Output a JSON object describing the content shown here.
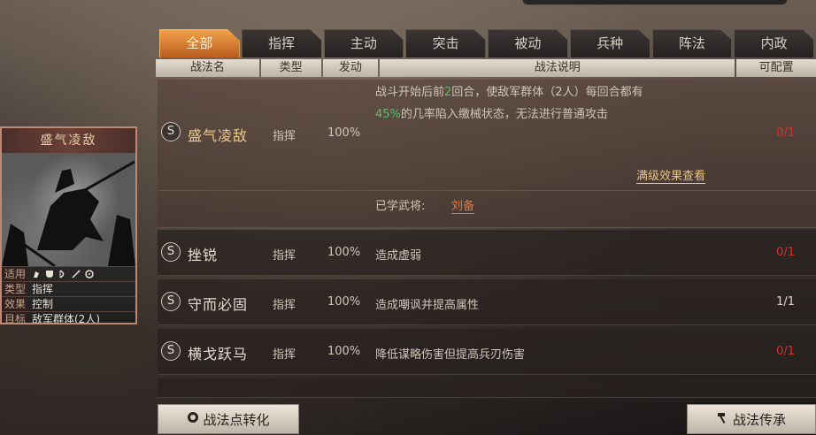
{
  "tabs": [
    {
      "label": "全部",
      "active": true
    },
    {
      "label": "指挥",
      "active": false
    },
    {
      "label": "主动",
      "active": false
    },
    {
      "label": "突击",
      "active": false
    },
    {
      "label": "被动",
      "active": false
    },
    {
      "label": "兵种",
      "active": false
    },
    {
      "label": "阵法",
      "active": false
    },
    {
      "label": "内政",
      "active": false
    }
  ],
  "table_headers": {
    "name": "战法名",
    "type": "类型",
    "rate": "发动",
    "desc": "战法说明",
    "config": "可配置"
  },
  "card": {
    "title": "盛气凌敌",
    "rows": [
      {
        "key": "适用",
        "value": ""
      },
      {
        "key": "类型",
        "value": "指挥"
      },
      {
        "key": "效果",
        "value": "控制"
      },
      {
        "key": "目标",
        "value": "敌军群体(2人)"
      }
    ]
  },
  "skills": [
    {
      "name": "盛气凌敌",
      "type": "指挥",
      "rate": "100%",
      "desc_line1_a": "战斗开始后前",
      "desc_line1_num": "2",
      "desc_line1_b": "回合，使敌军群体（2人）每回合都有",
      "desc_line2_num": "45%",
      "desc_line2_b": "的几率陷入缴械状态，无法进行普通攻击",
      "count": "0/1",
      "full_effect_link": "满级效果查看",
      "learned_label": "已学武将:",
      "learned_general": "刘备"
    },
    {
      "name": "挫锐",
      "type": "指挥",
      "rate": "100%",
      "desc": "造成虚弱",
      "count": "0/1"
    },
    {
      "name": "守而必固",
      "type": "指挥",
      "rate": "100%",
      "desc": "造成嘲讽并提高属性",
      "count": "1/1"
    },
    {
      "name": "横戈跃马",
      "type": "指挥",
      "rate": "100%",
      "desc": "降低谋略伤害但提高兵刃伤害",
      "count": "0/1"
    }
  ],
  "s_badge": "S",
  "buttons": {
    "convert": "战法点转化",
    "inherit": "战法传承"
  },
  "colors": {
    "active_tab": "#e08a38",
    "count_unfilled": "#d8342a",
    "highlight_value": "#55c067",
    "learned_general": "#e7743a"
  }
}
